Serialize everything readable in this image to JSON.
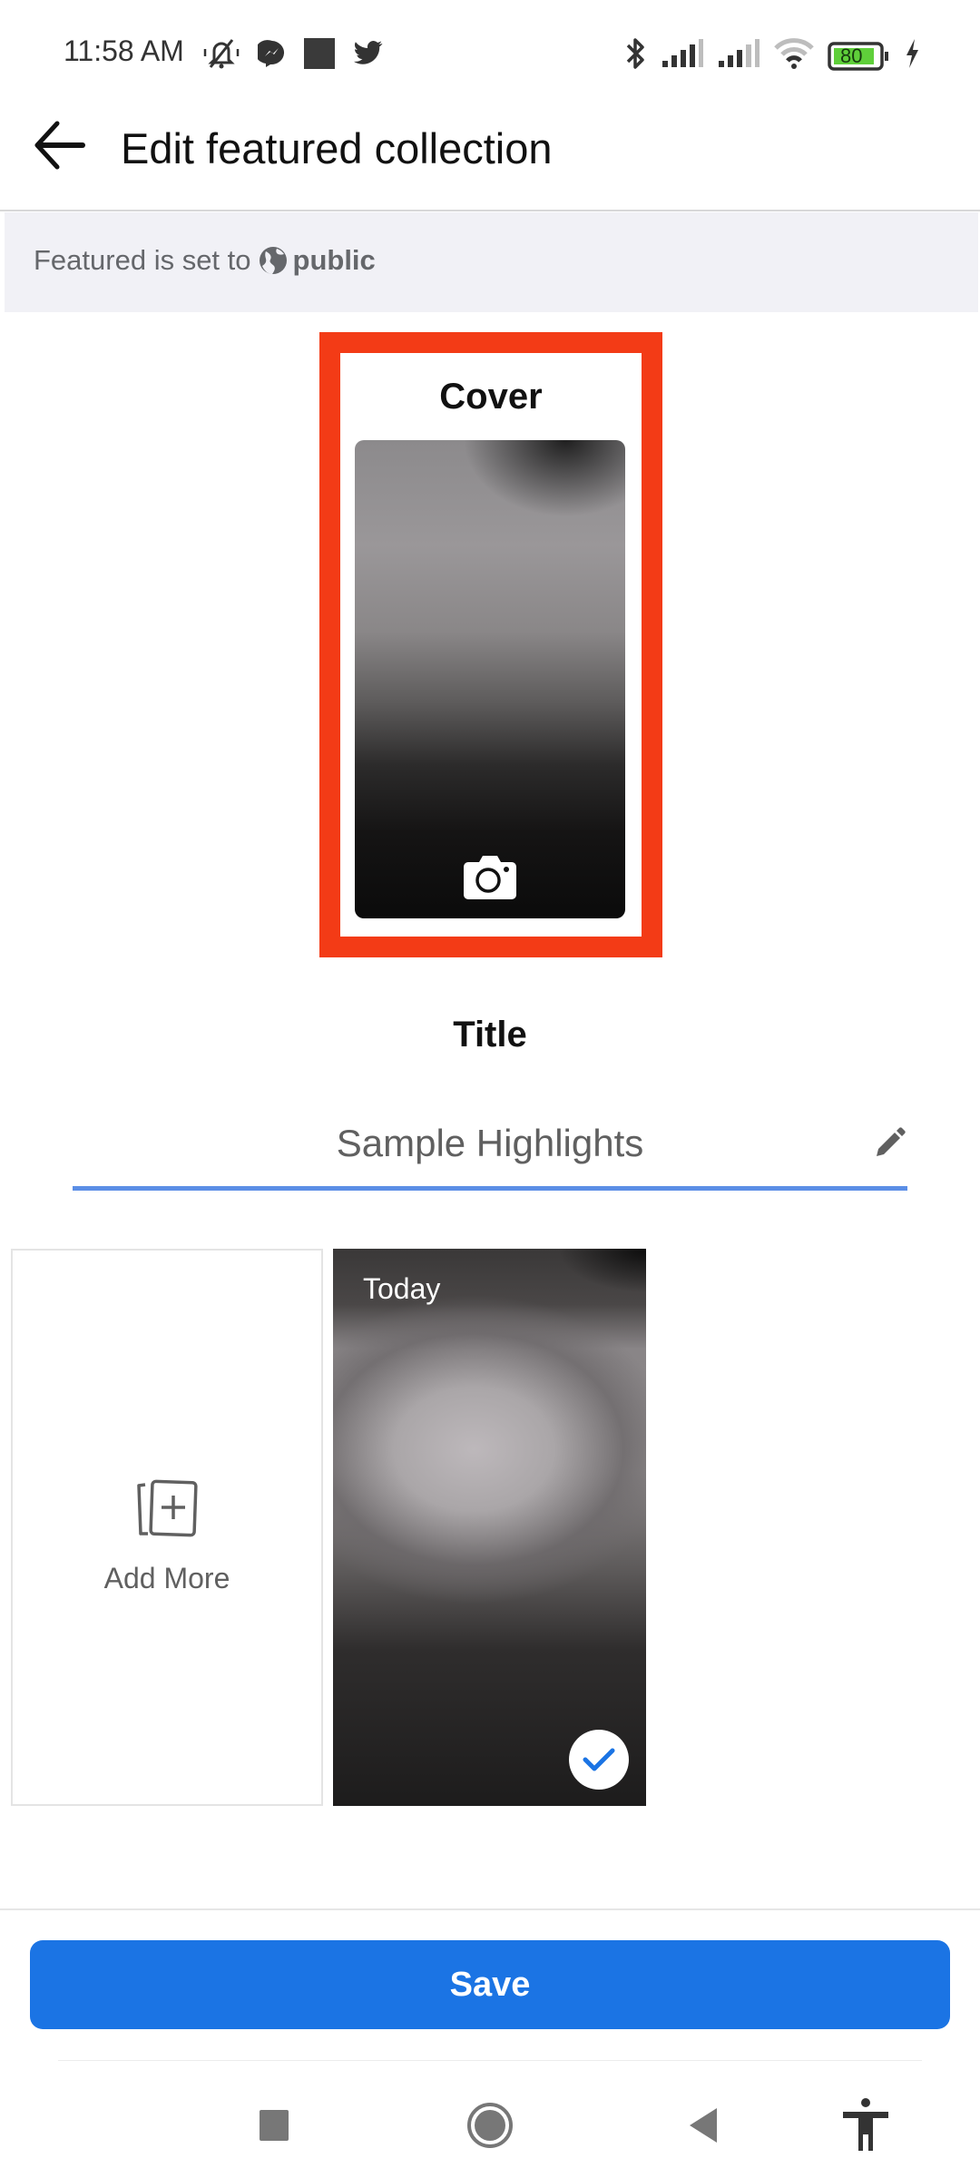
{
  "status_bar": {
    "time": "11:58 AM",
    "left_icons": [
      "notifications-muted-icon",
      "messenger-icon",
      "square-app-icon",
      "twitter-icon"
    ],
    "right_icons": [
      "bluetooth-icon",
      "signal-1-icon",
      "signal-2-icon",
      "wifi-icon",
      "battery-icon",
      "charging-icon"
    ],
    "battery_level": "80",
    "battery_color": "#5fcf3a"
  },
  "header": {
    "back_icon": "arrow-left-icon",
    "title": "Edit featured collection"
  },
  "banner": {
    "prefix": "Featured is set to",
    "privacy_icon": "globe-icon",
    "privacy_value": "public"
  },
  "cover": {
    "label": "Cover",
    "camera_icon": "camera-icon",
    "highlight_color": "#f33b16"
  },
  "title_section": {
    "label": "Title",
    "input_value": "Sample Highlights",
    "edit_icon": "pencil-icon",
    "underline_color": "#5b8ee6"
  },
  "items": {
    "add_more": {
      "label": "Add More",
      "icon": "add-cards-icon"
    },
    "stories": [
      {
        "date_label": "Today",
        "selected": true,
        "selected_icon": "check-icon"
      }
    ]
  },
  "footer": {
    "save_label": "Save",
    "save_color": "#1b74e4"
  },
  "nav_bar": {
    "buttons": [
      "recents-icon",
      "home-icon",
      "back-icon",
      "accessibility-icon"
    ]
  }
}
